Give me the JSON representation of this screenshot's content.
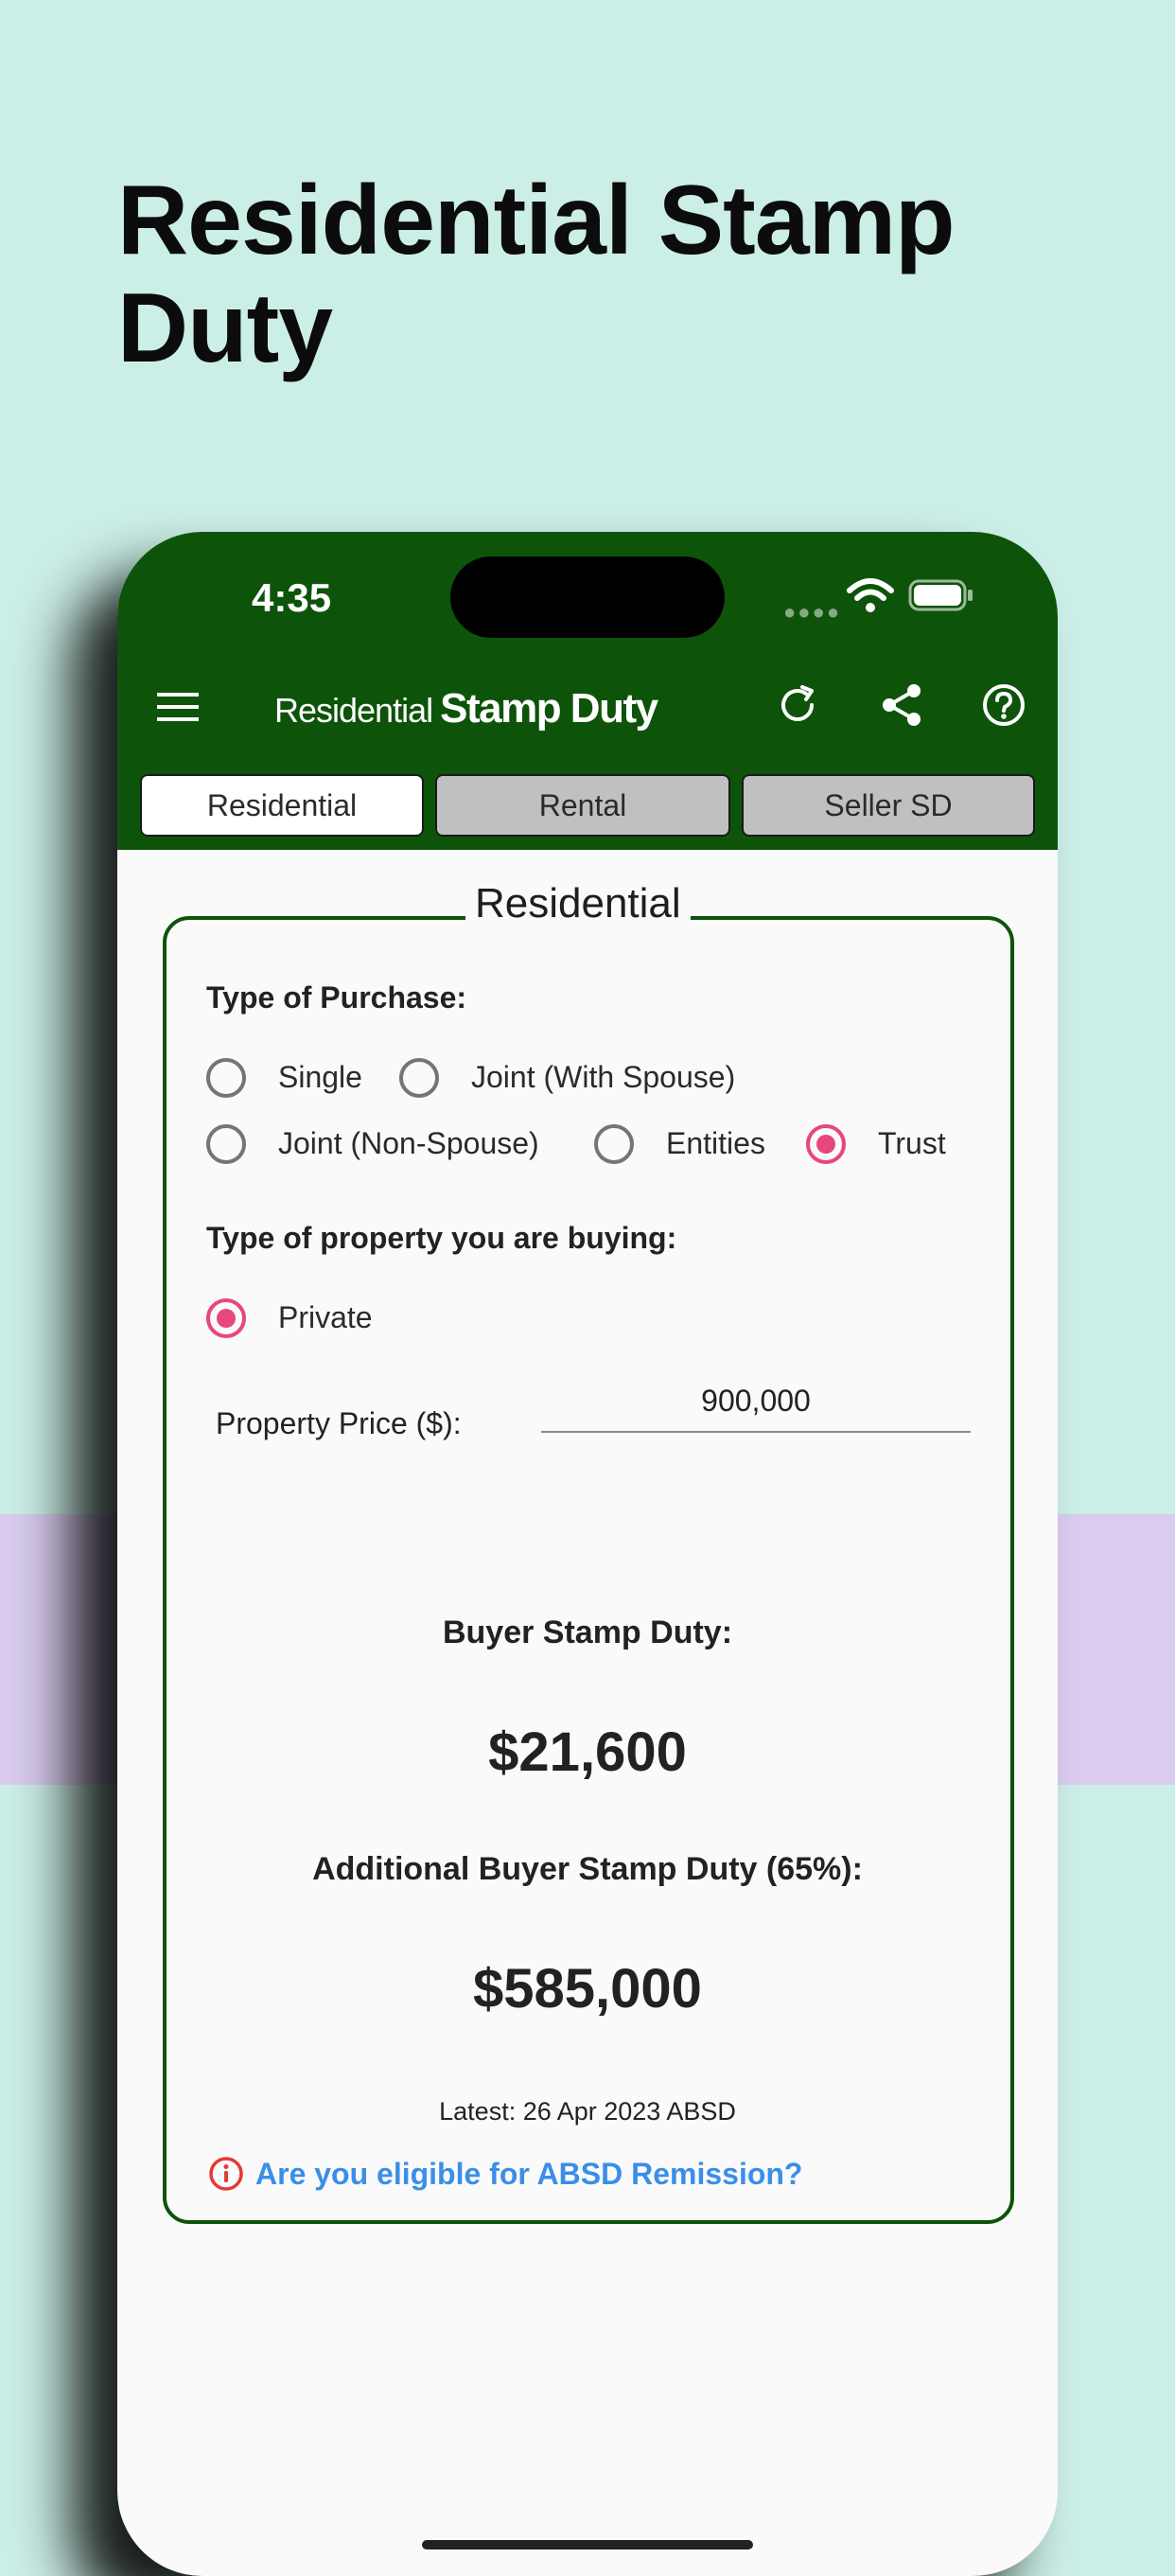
{
  "promo": {
    "headline": "Residential Stamp Duty"
  },
  "status_bar": {
    "time": "4:35"
  },
  "app_bar": {
    "title_light": "Residential",
    "title_bold": "Stamp Duty",
    "icons": [
      "menu-icon",
      "refresh-icon",
      "share-icon",
      "help-icon"
    ]
  },
  "tabs": [
    {
      "label": "Residential",
      "active": true
    },
    {
      "label": "Rental",
      "active": false
    },
    {
      "label": "Seller SD",
      "active": false
    }
  ],
  "card": {
    "legend": "Residential",
    "purchase_type": {
      "label": "Type of Purchase:",
      "options": [
        {
          "label": "Single",
          "selected": false
        },
        {
          "label": "Joint (With Spouse)",
          "selected": false
        },
        {
          "label": "Joint (Non-Spouse)",
          "selected": false
        },
        {
          "label": "Entities",
          "selected": false
        },
        {
          "label": "Trust",
          "selected": true
        }
      ]
    },
    "property_type": {
      "label": "Type of property you are buying:",
      "options": [
        {
          "label": "Private",
          "selected": true
        }
      ]
    },
    "price": {
      "label": "Property Price ($):",
      "value": "900,000"
    },
    "results": {
      "bsd_label": "Buyer Stamp Duty:",
      "bsd_value": "$21,600",
      "absd_label": "Additional Buyer Stamp Duty (65%):",
      "absd_value": "$585,000"
    },
    "latest": "Latest: 26 Apr 2023 ABSD",
    "remission_link": "Are you eligible for ABSD Remission?"
  },
  "colors": {
    "background": "#cbeee6",
    "band": "#d9ccee",
    "app_bar": "#0d540a",
    "radio_selected": "#e8477b",
    "link": "#3b8ee8",
    "info_icon": "#e53935"
  }
}
